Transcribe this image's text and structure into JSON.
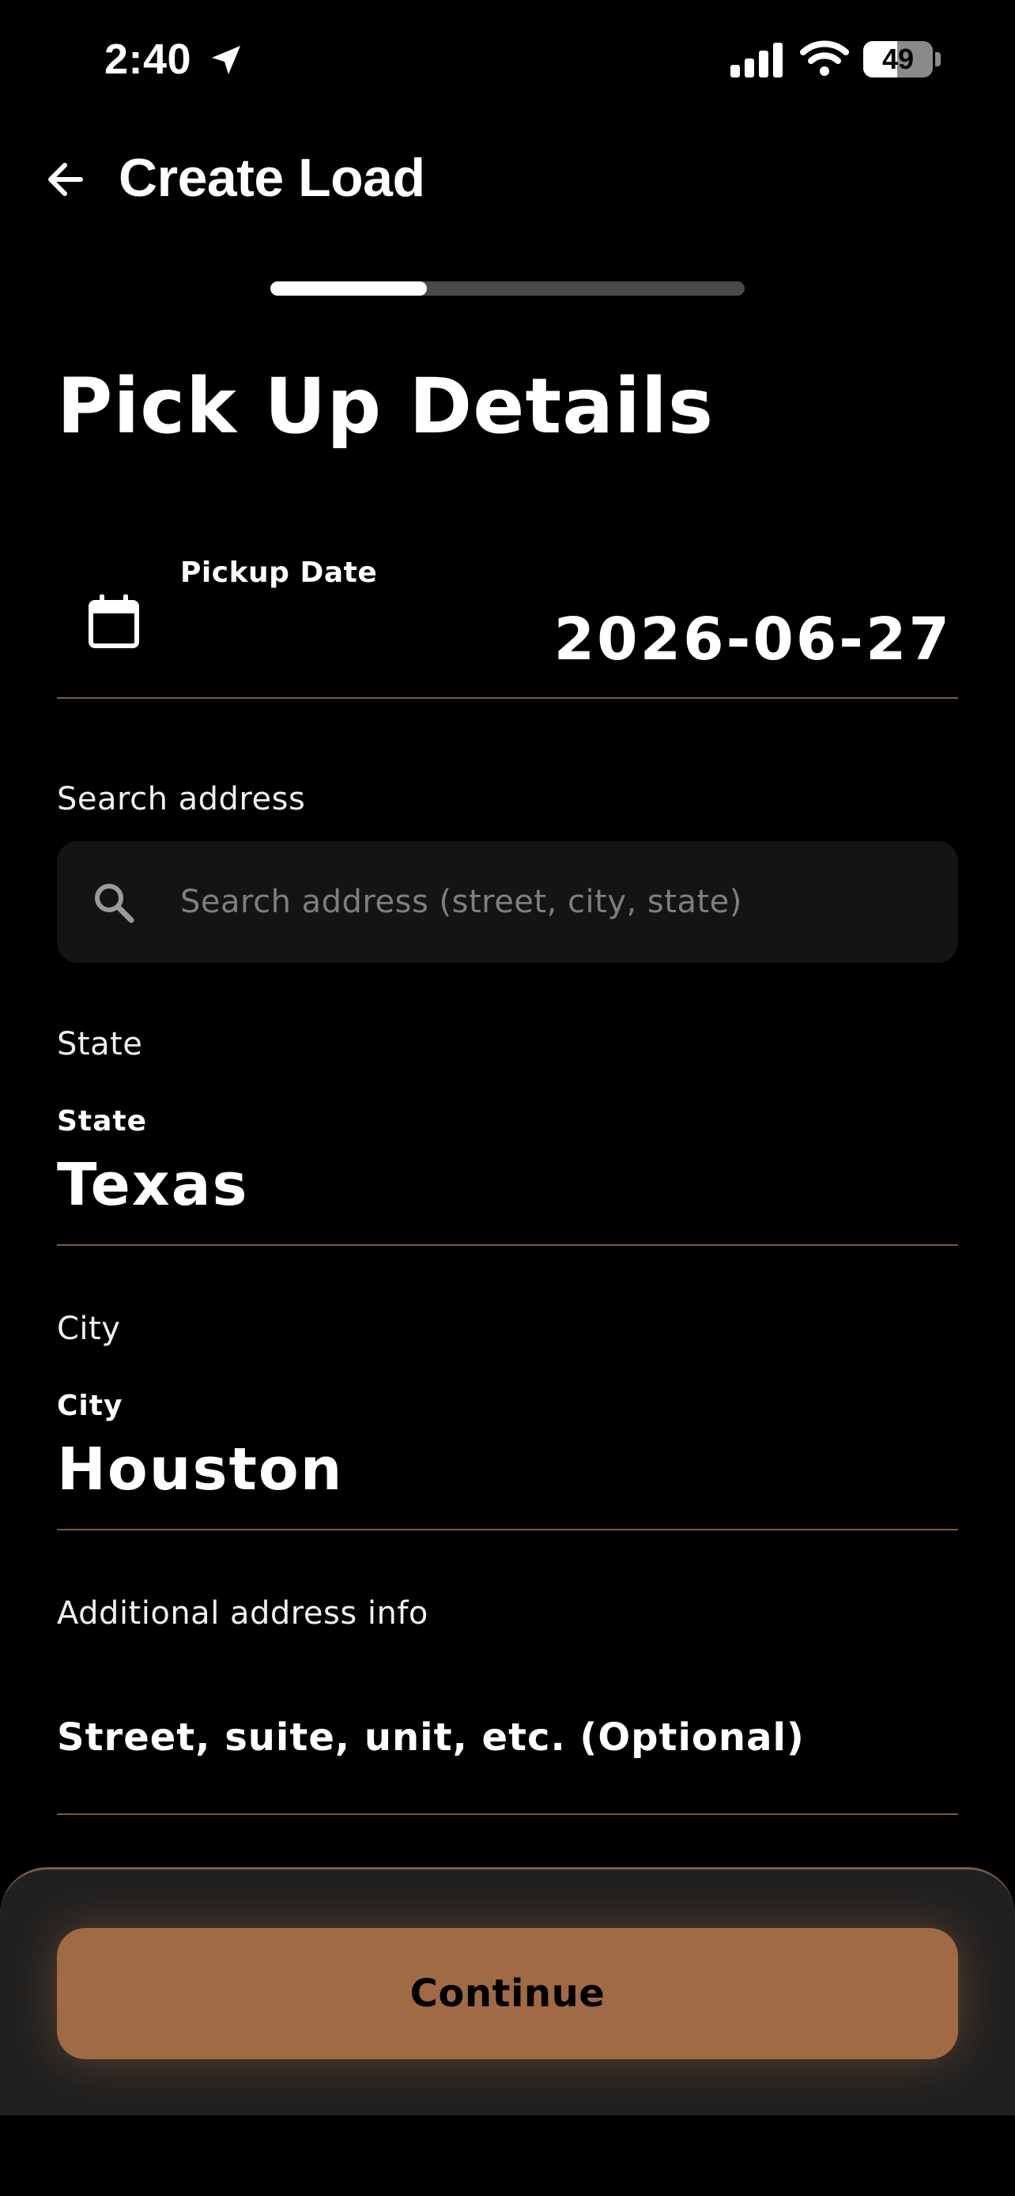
{
  "status_bar": {
    "time": "2:40",
    "battery_level": "49",
    "battery_fraction": 0.49
  },
  "header": {
    "title": "Create Load"
  },
  "progress": {
    "fraction": 0.33
  },
  "page": {
    "title": "Pick Up Details"
  },
  "pickup_date": {
    "label": "Pickup Date",
    "value": "2026-06-27"
  },
  "search": {
    "section_label": "Search address",
    "placeholder": "Search address (street, city, state)",
    "value": ""
  },
  "state": {
    "section_label": "State",
    "field_label": "State",
    "value": "Texas"
  },
  "city": {
    "section_label": "City",
    "field_label": "City",
    "value": "Houston"
  },
  "additional": {
    "section_label": "Additional address info",
    "placeholder": "Street, suite, unit, etc. (Optional)"
  },
  "footer": {
    "continue_label": "Continue"
  },
  "colors": {
    "accent": "#a06a44",
    "divider": "#7a5a45",
    "background": "#000000"
  }
}
